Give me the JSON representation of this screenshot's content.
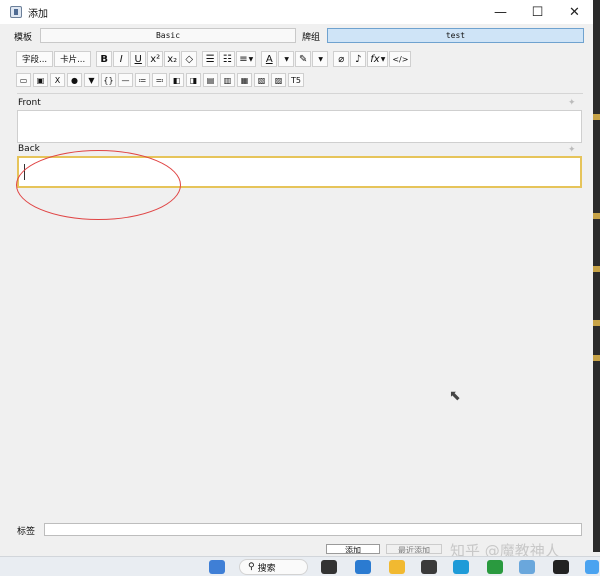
{
  "window": {
    "title": "添加",
    "minimize_glyph": "—",
    "maximize_glyph": "☐",
    "close_glyph": "✕"
  },
  "top": {
    "notetype_label": "模板",
    "notetype_value": "Basic",
    "deck_label": "牌组",
    "deck_value": "test"
  },
  "toolbar1": {
    "fields_btn": "字段...",
    "cards_btn": "卡片...",
    "bold": "B",
    "italic": "I",
    "underline": "U",
    "superscript": "x²",
    "subscript": "x₂",
    "eraser": "◇",
    "ul": "☰",
    "ol": "☷",
    "align": "≡",
    "font_color": "A",
    "highlight": "✎",
    "attach": "⌀",
    "record": "♪",
    "mathjax": "fx",
    "html": "</>"
  },
  "toolbar2": {
    "b1": "▭",
    "b2": "▣",
    "b3": "ⵝ",
    "b4": "●",
    "b5": "▼",
    "b6": "{}",
    "b7": "—",
    "b8": "≔",
    "b9": "≕",
    "b10": "◧",
    "b11": "◨",
    "b12": "▤",
    "b13": "▥",
    "b14": "▦",
    "b15": "▧",
    "b16": "▨",
    "b17": "T5"
  },
  "fields": {
    "front_label": "Front",
    "back_label": "Back"
  },
  "bottom": {
    "tags_label": "标签",
    "add_button": "添加",
    "history_button": "最近添加"
  },
  "watermark": "知乎 @魔教神人",
  "taskbar": {
    "search_label": "搜索"
  },
  "colors": {
    "focus_border": "#e6c45a",
    "annotation": "#e04545",
    "deck_button": "#cfe4f7"
  }
}
